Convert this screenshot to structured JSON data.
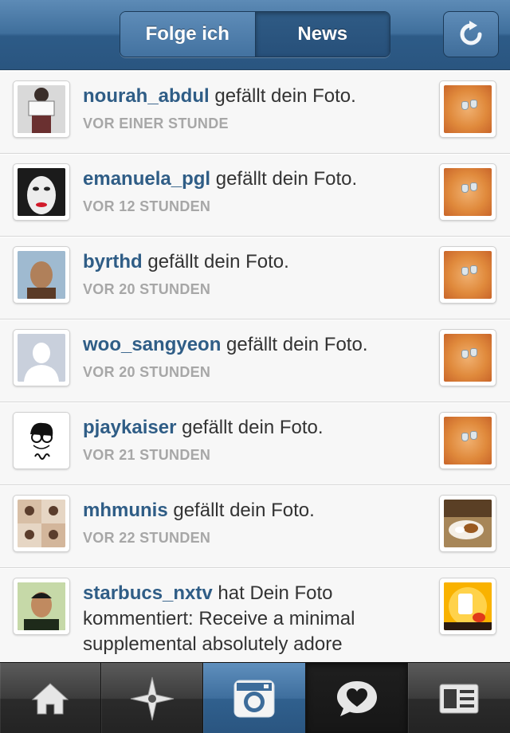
{
  "header": {
    "tabs": [
      {
        "label": "Folge ich",
        "active": false
      },
      {
        "label": "News",
        "active": true
      }
    ],
    "refresh_icon": "refresh-icon",
    "accent_color": "#3f6f9c"
  },
  "activity": [
    {
      "username": "nourah_abdul",
      "action": "gefällt dein Foto.",
      "time": "VOR EINER STUNDE"
    },
    {
      "username": "emanuela_pgl",
      "action": "gefällt dein Foto.",
      "time": "VOR 12 STUNDEN"
    },
    {
      "username": "byrthd",
      "action": "gefällt dein Foto.",
      "time": "VOR 20 STUNDEN"
    },
    {
      "username": "woo_sangyeon",
      "action": "gefällt dein Foto.",
      "time": "VOR 20 STUNDEN"
    },
    {
      "username": "pjaykaiser",
      "action": "gefällt dein Foto.",
      "time": "VOR 21 STUNDEN"
    },
    {
      "username": "mhmunis",
      "action": "gefällt dein Foto.",
      "time": "VOR 22 STUNDEN"
    },
    {
      "username": "starbucs_nxtv",
      "action": "hat Dein Foto kommentiert: Receive a minimal supplemental absolutely adore",
      "time": ""
    }
  ],
  "tabbar": {
    "items": [
      {
        "icon": "home-icon",
        "active": false
      },
      {
        "icon": "explore-icon",
        "active": false
      },
      {
        "icon": "camera-icon",
        "active": false
      },
      {
        "icon": "news-heart-icon",
        "active": true
      },
      {
        "icon": "profile-icon",
        "active": false
      }
    ]
  },
  "text_color_username": "#2f5d86",
  "text_color_time": "#a7a7a7"
}
